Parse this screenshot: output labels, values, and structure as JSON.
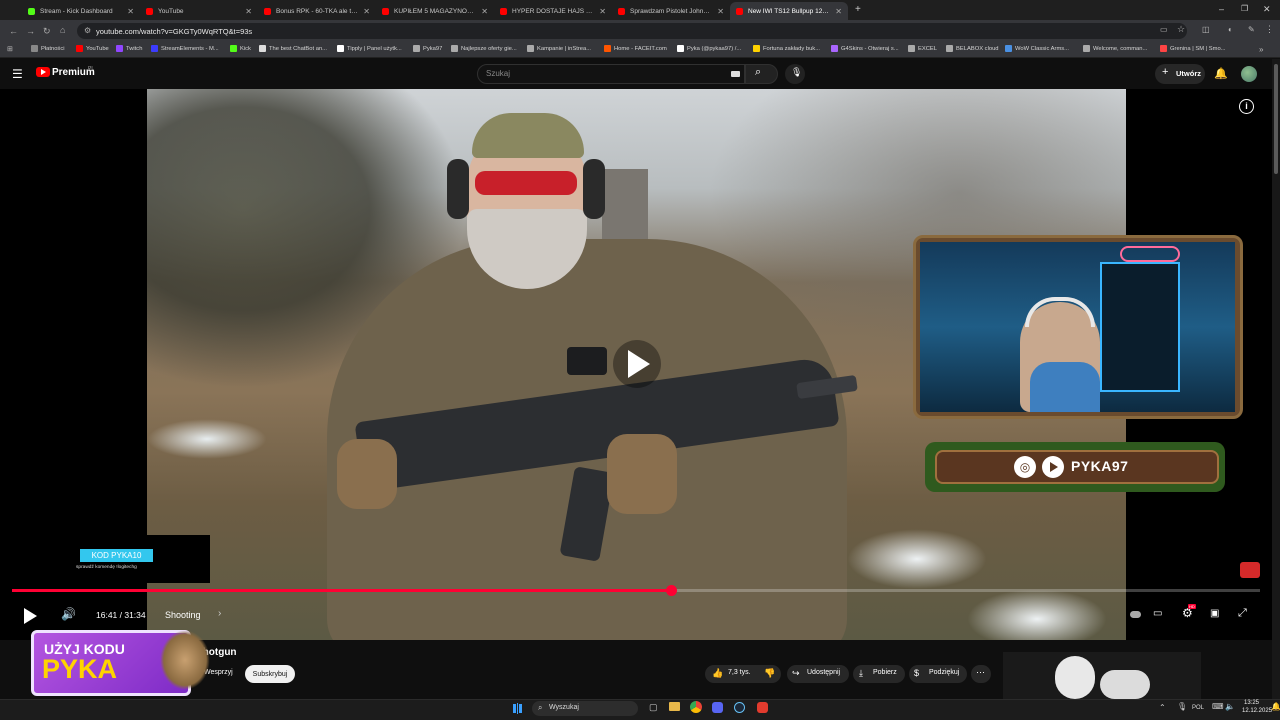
{
  "tabs": [
    {
      "title": "Stream - Kick Dashboard",
      "color": "#53fc18",
      "active": false
    },
    {
      "title": "YouTube",
      "color": "#ff0000",
      "active": false
    },
    {
      "title": "Bonus RPK - 60-TKA ale to LAS",
      "color": "#ff0000",
      "active": false
    },
    {
      "title": "KUPIŁEM 5 MAGAZYNÓW I ZA",
      "color": "#ff0000",
      "active": false
    },
    {
      "title": "HYPER DOSTAJE HAJS OD FALL",
      "color": "#ff0000",
      "active": false
    },
    {
      "title": "Sprawdzam Pistolet Johna Wi",
      "color": "#ff0000",
      "active": false
    },
    {
      "title": "New IWI TS12 Bullpup 12ga Sh",
      "color": "#ff0000",
      "active": true
    }
  ],
  "address": {
    "url": "youtube.com/watch?v=GKGTy0WqRTQ&t=93s"
  },
  "bookmarks": [
    {
      "label": "Płatności",
      "color": "#888888"
    },
    {
      "label": "YouTube",
      "color": "#ff0000"
    },
    {
      "label": "Twitch",
      "color": "#9146ff"
    },
    {
      "label": "StreamElements - M...",
      "color": "#3c3cff"
    },
    {
      "label": "Kick",
      "color": "#53fc18"
    },
    {
      "label": "The best ChatBot an...",
      "color": "#dddddd"
    },
    {
      "label": "Tipply | Panel użytk...",
      "color": "#ffffff"
    },
    {
      "label": "Pyka97",
      "color": "#aaaaaa"
    },
    {
      "label": "Najlepsze oferty gie...",
      "color": "#aaaaaa"
    },
    {
      "label": "Kampanie | inStrea...",
      "color": "#aaaaaa"
    },
    {
      "label": "Home - FACEIT.com",
      "color": "#ff5500"
    },
    {
      "label": "Pyka (@pykaa97) /...",
      "color": "#ffffff"
    },
    {
      "label": "Fortuna zakłady buk...",
      "color": "#ffd200"
    },
    {
      "label": "G4Skins - Otwieraj s...",
      "color": "#aa66ff"
    },
    {
      "label": "EXCEL",
      "color": "#aaaaaa"
    },
    {
      "label": "BELABOX cloud",
      "color": "#aaaaaa"
    },
    {
      "label": "WoW Classic Arms...",
      "color": "#4a90e2"
    },
    {
      "label": "Welcome, comman...",
      "color": "#aaaaaa"
    },
    {
      "label": "Grenina | SM | Smo...",
      "color": "#ff4444"
    }
  ],
  "yt": {
    "brand": "Premium",
    "region": "PL",
    "search_placeholder": "Szukaj",
    "create_label": "Utwórz"
  },
  "player": {
    "time": "16:41 / 31:34",
    "chapter": "Shooting",
    "progress": 0.528,
    "promo_code": "KOD PYKA10",
    "promo_sub": "sprawdź komendę !logitechg",
    "social_handle": "PYKA97",
    "hd_badge": "HD"
  },
  "video_meta": {
    "title": "Shotgun",
    "support_label": "Wesprzyj",
    "subscribe_label": "Subskrybuj",
    "likes": "7,3 tys.",
    "share_label": "Udostępnij",
    "download_label": "Pobierz",
    "thanks_label": "Podziękuj"
  },
  "overlay_ad": {
    "line1": "UŻYJ KODU",
    "line2": "PYKA"
  },
  "taskbar": {
    "search_label": "Wyszukaj",
    "lang": "POL",
    "time": "13:25",
    "date": "12.12.2025"
  }
}
